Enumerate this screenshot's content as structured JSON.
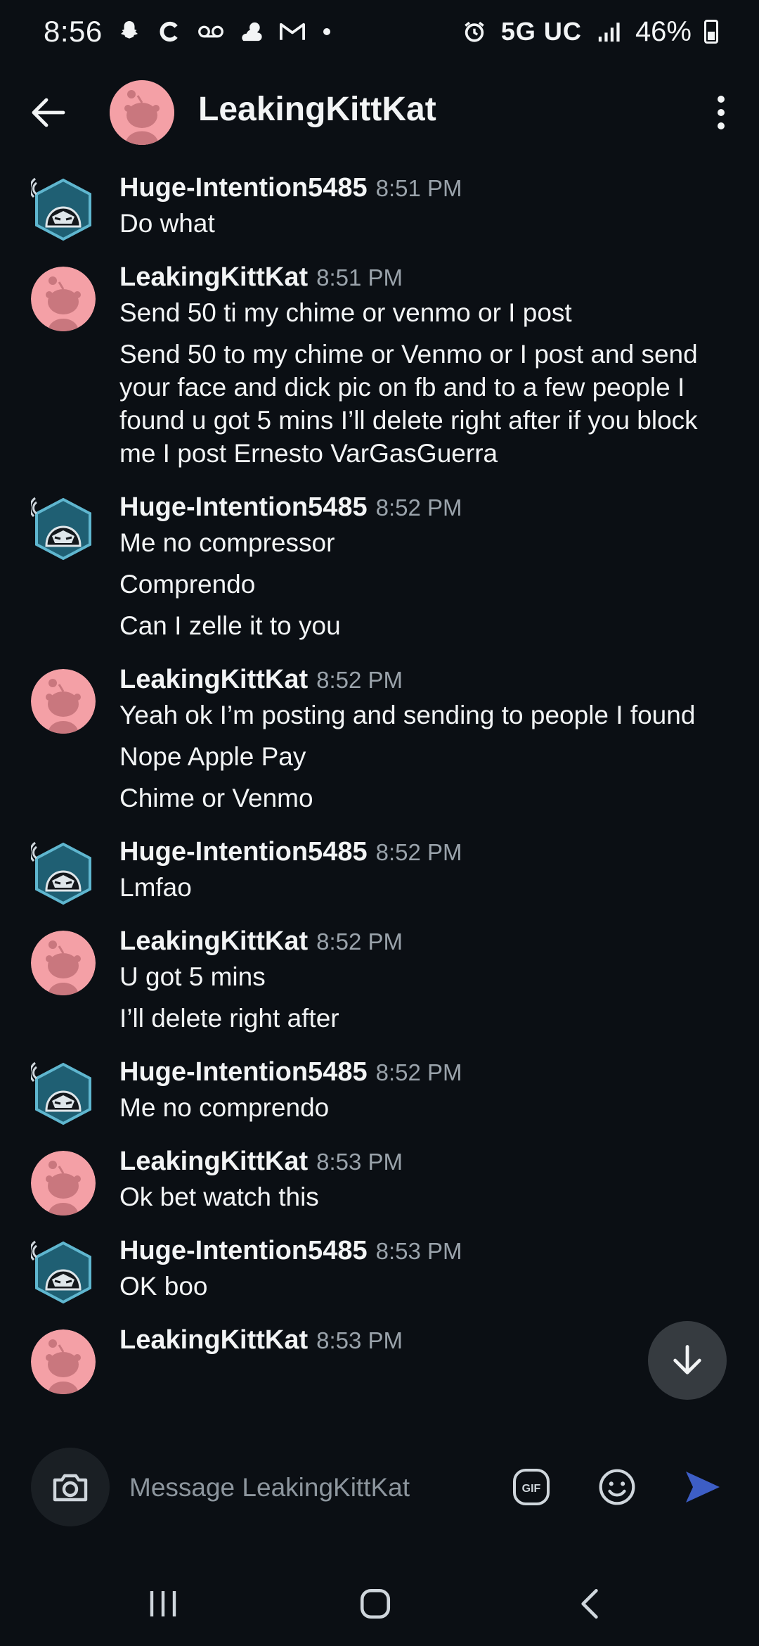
{
  "status_bar": {
    "time": "8:56",
    "network": "5G UC",
    "battery": "46%",
    "icons": [
      "snapchat-icon",
      "c-icon",
      "voicemail-icon",
      "weather-icon",
      "gmail-icon",
      "dot-icon",
      "alarm-icon",
      "signal-icon",
      "battery-icon"
    ]
  },
  "header": {
    "title": "LeakingKittKat",
    "back_icon": "arrow-left-icon",
    "more_icon": "more-vertical-icon"
  },
  "messages": [
    {
      "author": "Huge-Intention5485",
      "time": "8:51 PM",
      "avatar": "snoo-hooded-icon",
      "lines": [
        "Do what"
      ]
    },
    {
      "author": "LeakingKittKat",
      "time": "8:51 PM",
      "avatar": "snoo-pink-icon",
      "lines": [
        "Send 50 ti my chime or venmo or I post",
        "Send 50 to my chime or Venmo or I post and send your face and dick pic on fb and to a few people I found u got 5 mins I’ll delete right after if you block me I post Ernesto VarGasGuerra"
      ]
    },
    {
      "author": "Huge-Intention5485",
      "time": "8:52 PM",
      "avatar": "snoo-hooded-icon",
      "lines": [
        "Me no compressor",
        "Comprendo",
        "Can I zelle it to you"
      ]
    },
    {
      "author": "LeakingKittKat",
      "time": "8:52 PM",
      "avatar": "snoo-pink-icon",
      "lines": [
        "Yeah ok I’m posting and sending to people I found",
        "Nope Apple Pay",
        "Chime or Venmo"
      ]
    },
    {
      "author": "Huge-Intention5485",
      "time": "8:52 PM",
      "avatar": "snoo-hooded-icon",
      "lines": [
        "Lmfao"
      ]
    },
    {
      "author": "LeakingKittKat",
      "time": "8:52 PM",
      "avatar": "snoo-pink-icon",
      "lines": [
        "U got 5 mins",
        "I’ll delete right after"
      ]
    },
    {
      "author": "Huge-Intention5485",
      "time": "8:52 PM",
      "avatar": "snoo-hooded-icon",
      "lines": [
        "Me no comprendo"
      ]
    },
    {
      "author": "LeakingKittKat",
      "time": "8:53 PM",
      "avatar": "snoo-pink-icon",
      "lines": [
        "Ok bet watch this"
      ]
    },
    {
      "author": "Huge-Intention5485",
      "time": "8:53 PM",
      "avatar": "snoo-hooded-icon",
      "lines": [
        "OK boo"
      ]
    },
    {
      "author": "LeakingKittKat",
      "time": "8:53 PM",
      "avatar": "snoo-pink-icon",
      "lines": []
    }
  ],
  "composer": {
    "placeholder": "Message LeakingKittKat",
    "value": "",
    "gif_label": "GIF"
  },
  "colors": {
    "background": "#0b0f14",
    "text": "#f2f4f5",
    "muted": "#9aa3ab",
    "avatar_pink": "#f4a0a6",
    "avatar_teal": "#1f5f73",
    "send_blue": "#3d5ec6"
  }
}
